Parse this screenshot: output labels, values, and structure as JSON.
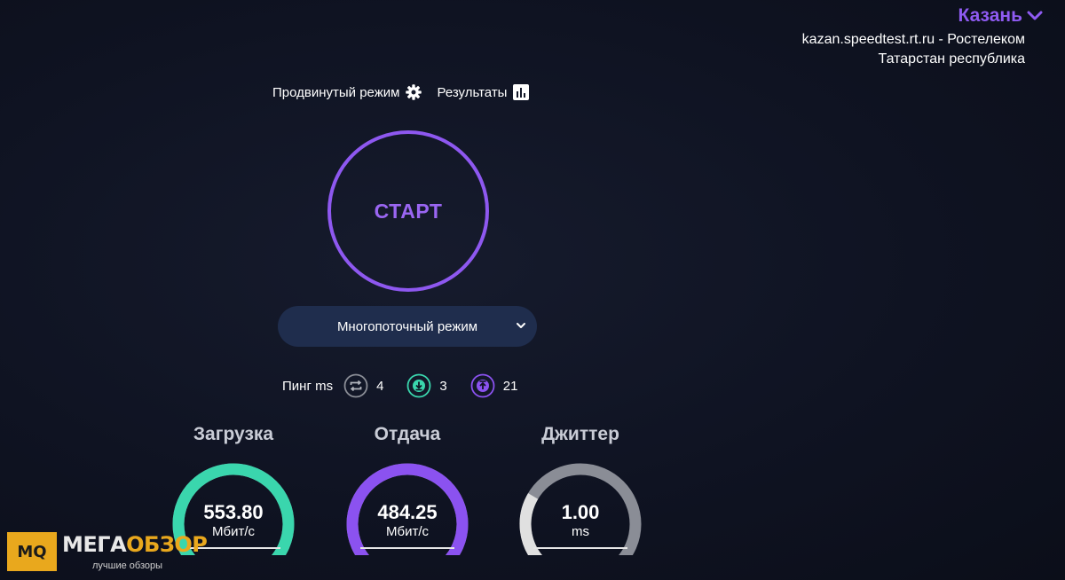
{
  "location": {
    "city": "Казань",
    "server": "kazan.speedtest.rt.ru - Ростелеком",
    "region": "Татарстан республика"
  },
  "toolbar": {
    "advanced_mode_label": "Продвинутый режим",
    "results_label": "Результаты"
  },
  "start": {
    "label": "СТАРТ"
  },
  "mode_select": {
    "selected": "Многопоточный режим"
  },
  "ping": {
    "label": "Пинг ms",
    "idle": "4",
    "download": "3",
    "upload": "21"
  },
  "gauges": {
    "download": {
      "title": "Загрузка",
      "value": "553.80",
      "unit": "Мбит/с",
      "fill": 1.0,
      "color": "#3ad6ad"
    },
    "upload": {
      "title": "Отдача",
      "value": "484.25",
      "unit": "Мбит/с",
      "fill": 1.0,
      "color": "#8b52f0"
    },
    "jitter": {
      "title": "Джиттер",
      "value": "1.00",
      "unit": "ms",
      "fill": 0.28,
      "color": "#e0e0e0"
    }
  },
  "watermark": {
    "badge": "MQ",
    "name_part1": "МЕГА",
    "name_part2": "ОБЗОР",
    "tagline": "лучшие обзоры"
  },
  "colors": {
    "accent_purple": "#8e58f0",
    "accent_green": "#3ad6ad",
    "gauge_track": "#8a8d96"
  }
}
